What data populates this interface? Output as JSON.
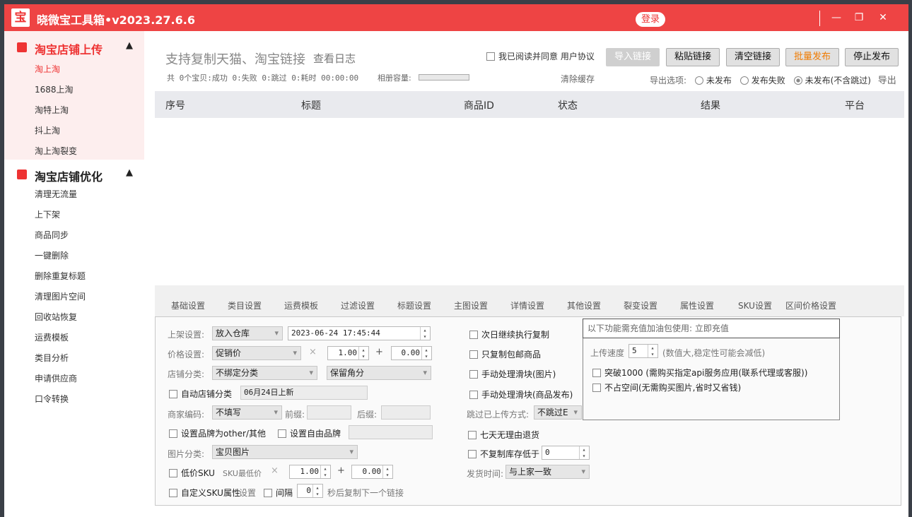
{
  "app": {
    "title": "晓微宝工具箱•v2023.27.6.6",
    "logo_char": "宝",
    "login_label": "登录",
    "accent": "#ee4444",
    "controls": [
      "—",
      "❐",
      "✕"
    ]
  },
  "sidebar": {
    "groups": [
      {
        "label": "淘宝店铺上传",
        "icon": "upload-icon",
        "items": [
          "淘上淘",
          "1688上淘",
          "淘特上淘",
          "抖上淘",
          "淘上淘裂变"
        ],
        "active": "淘上淘"
      },
      {
        "label": "淘宝店铺优化",
        "icon": "chart-icon",
        "items": [
          "清理无流量",
          "上下架",
          "商品同步",
          "一键删除",
          "删除重复标题",
          "清理图片空间",
          "回收站恢复",
          "运费模板",
          "类目分析",
          "申请供应商",
          "口令转换"
        ]
      }
    ]
  },
  "header": {
    "title": "支持复制天猫、淘宝链接",
    "view_log": "查看日志",
    "stats": "共 0个宝贝:成功 0:失败 0:跳过 0:耗时 00:00:00",
    "album_label": "相册容量:",
    "clear_cache": "清除缓存",
    "agree_label": "我已阅读并同意",
    "user_agreement": "用户协议",
    "buttons": {
      "import": "导入链接",
      "paste": "粘贴链接",
      "clear": "清空链接",
      "batch": "批量发布",
      "stop": "停止发布"
    },
    "export": {
      "label": "导出选项:",
      "opts": [
        "未发布",
        "发布失败",
        "未发布(不含跳过)"
      ],
      "selected": 2,
      "action": "导出"
    }
  },
  "table": {
    "columns": [
      "序号",
      "标题",
      "商品ID",
      "状态",
      "结果",
      "平台"
    ]
  },
  "tabs": [
    "基础设置",
    "类目设置",
    "运费模板",
    "过滤设置",
    "标题设置",
    "主图设置",
    "详情设置",
    "其他设置",
    "裂变设置",
    "属性设置",
    "SKU设置",
    "区间价格设置"
  ],
  "settings": {
    "shelf_label": "上架设置:",
    "shelf_value": "放入仓库",
    "shelf_time": "2023-06-24 17:45:44",
    "price_label": "价格设置:",
    "price_value": "促销价",
    "times": "×",
    "mult": "1.00",
    "plus": "+",
    "add": "0.00",
    "cat_label": "店铺分类:",
    "cat_value": "不绑定分类",
    "cents_value": "保留角分",
    "auto_cat": "自动店铺分类",
    "auto_cat_value": "06月24日上新",
    "code_label": "商家编码:",
    "code_value": "不填写",
    "prefix": "前缀:",
    "suffix": "后缀:",
    "brand_other": "设置品牌为other/其他",
    "brand_free": "设置自由品牌",
    "img_label": "图片分类:",
    "img_value": "宝贝图片",
    "low_sku": "低价SKU",
    "sku_min": "SKU最低价",
    "sku_mult": "1.00",
    "sku_add": "0.00",
    "custom_sku": "自定义SKU属性",
    "custom_sku_set": "设置",
    "interval": "间隔",
    "interval_value": "0",
    "interval_suffix": "秒后复制下一个链接",
    "next_day": "次日继续执行复制",
    "free_ship": "只复制包邮商品",
    "slider_img": "手动处理滑块(图片)",
    "slider_pub": "手动处理滑块(商品发布)",
    "skip_label": "跳过已上传方式:",
    "skip_value": "不跳过E",
    "seven_day": "七天无理由退货",
    "stock_low": "不复制库存低于",
    "stock_value": "0",
    "ship_label": "发货时间:",
    "ship_value": "与上家一致",
    "vip_header": "以下功能需充值加油包使用: 立即充值",
    "speed_label": "上传速度",
    "speed_value": "5",
    "speed_note": "(数值大,稳定性可能会减低)",
    "break1000": "突破1000 (需购买指定api服务应用(联系代理或客服))",
    "no_space": "不占空间(无需购买图片,省时又省钱)"
  }
}
